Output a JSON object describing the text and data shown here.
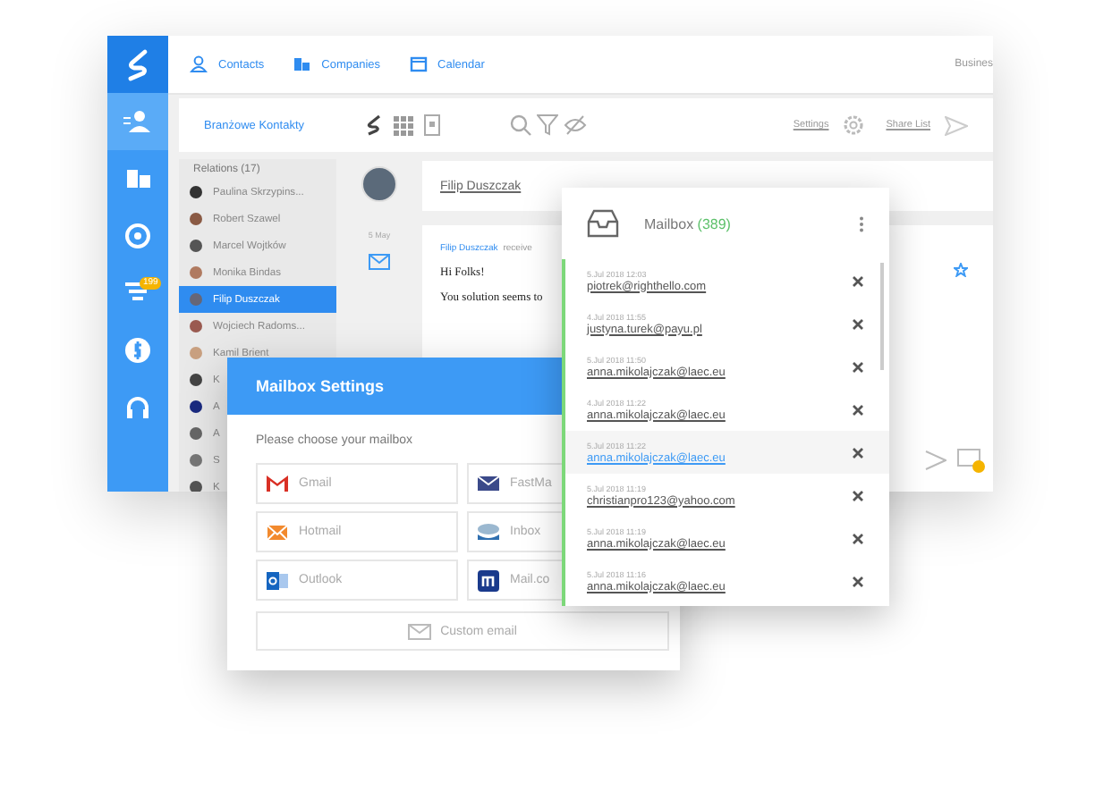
{
  "app": {
    "nav": [
      {
        "kind": "contacts",
        "label": "Contacts"
      },
      {
        "kind": "companies",
        "label": "Companies"
      },
      {
        "kind": "calendar",
        "label": "Calendar"
      }
    ],
    "nav_right": "Busines",
    "rail": [
      {
        "kind": "people",
        "selected": true
      },
      {
        "kind": "building",
        "selected": false
      },
      {
        "kind": "target",
        "selected": false
      },
      {
        "kind": "filter",
        "selected": false,
        "badge": "199"
      },
      {
        "kind": "dollar",
        "selected": false
      },
      {
        "kind": "headset",
        "selected": false
      }
    ],
    "toolbar": {
      "list_name": "Branżowe Kontakty",
      "settings": "Settings",
      "share": "Share List"
    },
    "relations": {
      "title": "Relations (17)",
      "items": [
        {
          "name": "Paulina Skrzypins...",
          "selected": false
        },
        {
          "name": "Robert Szawel",
          "selected": false
        },
        {
          "name": "Marcel Wojtków",
          "selected": false
        },
        {
          "name": "Monika Bindas",
          "selected": false
        },
        {
          "name": "Filip Duszczak",
          "selected": true
        },
        {
          "name": "Wojciech Radoms...",
          "selected": false
        },
        {
          "name": "Kamil Brient",
          "selected": false
        },
        {
          "name": "K",
          "selected": false
        },
        {
          "name": "A",
          "selected": false
        },
        {
          "name": "A",
          "selected": false
        },
        {
          "name": "S",
          "selected": false
        },
        {
          "name": "K",
          "selected": false
        }
      ]
    },
    "timeline_date": "5 May",
    "contact_name": "Filip Duszczak",
    "message": {
      "sender": "Filip Duszczak",
      "action": "receive",
      "greeting": "Hi Folks!",
      "body": "You solution seems to"
    }
  },
  "mailbox_settings": {
    "title": "Mailbox Settings",
    "prompt": "Please choose your mailbox",
    "options": [
      {
        "kind": "gmail",
        "label": "Gmail"
      },
      {
        "kind": "fastmail",
        "label": "FastMa"
      },
      {
        "kind": "hotmail",
        "label": "Hotmail"
      },
      {
        "kind": "inbox",
        "label": "Inbox"
      },
      {
        "kind": "outlook",
        "label": "Outlook"
      },
      {
        "kind": "mailcom",
        "label": "Mail.co"
      }
    ],
    "custom": "Custom email"
  },
  "mailbox": {
    "title": "Mailbox",
    "count": "(389)",
    "items": [
      {
        "date": "5.Jul 2018 12:03",
        "email": "piotrek@righthello.com",
        "selected": false
      },
      {
        "date": "4.Jul 2018 11:55",
        "email": "justyna.turek@payu.pl",
        "selected": false
      },
      {
        "date": "5.Jul 2018 11:50",
        "email": "anna.mikolajczak@laec.eu",
        "selected": false
      },
      {
        "date": "4.Jul 2018 11:22",
        "email": "anna.mikolajczak@laec.eu",
        "selected": false
      },
      {
        "date": "5.Jul 2018 11:22",
        "email": "anna.mikolajczak@laec.eu",
        "selected": true
      },
      {
        "date": "5.Jul 2018 11:19",
        "email": "christianpro123@yahoo.com",
        "selected": false
      },
      {
        "date": "5.Jul 2018 11:19",
        "email": "anna.mikolajczak@laec.eu",
        "selected": false
      },
      {
        "date": "5.Jul 2018 11:16",
        "email": "anna.mikolajczak@laec.eu",
        "selected": false
      }
    ]
  }
}
